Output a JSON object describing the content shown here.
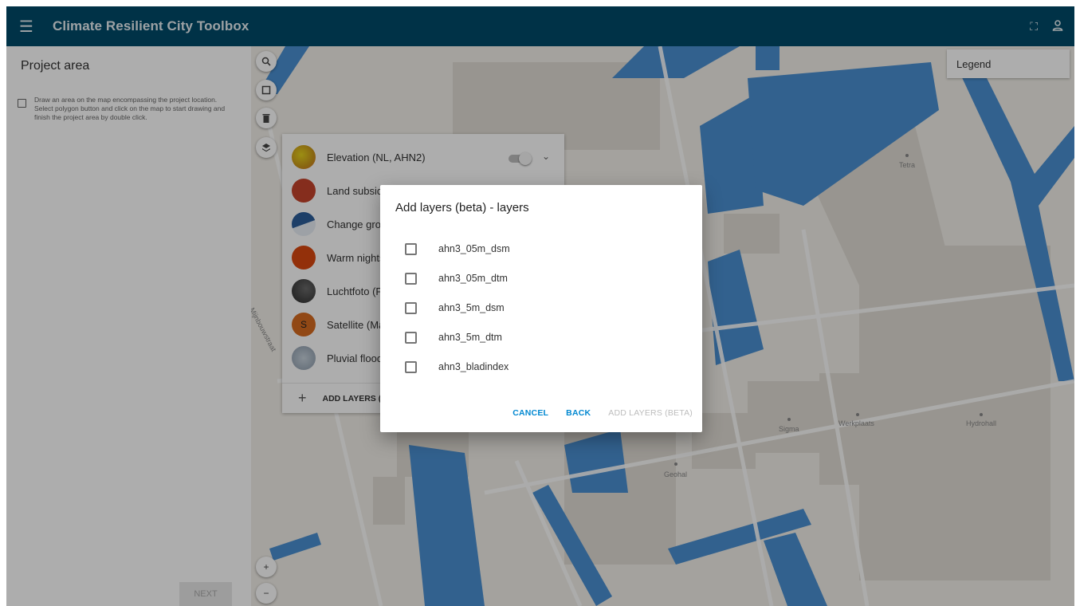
{
  "app": {
    "title": "Climate Resilient City Toolbox"
  },
  "panel": {
    "title": "Project area",
    "hint": "Draw an area on the map encompassing the project location. Select polygon button and click on the map to start drawing and finish the project area by double click.",
    "next_label": "NEXT"
  },
  "legend": {
    "label": "Legend"
  },
  "map_labels": {
    "tetra": "Tetra",
    "sigma": "Sigma",
    "werkplaats": "Werkplaats",
    "hydrohall": "Hydrohall",
    "geohal": "Geohal",
    "street": "Mijnbouwstraat"
  },
  "layers": {
    "items": [
      {
        "label": "Elevation (NL, AHN2)",
        "color": "#e8c21a"
      },
      {
        "label": "Land subsid",
        "color": "#c4432b"
      },
      {
        "label": "Change grou",
        "color": "#2c5d9a"
      },
      {
        "label": "Warm nights",
        "color": "#d9480f"
      },
      {
        "label": "Luchtfoto (P",
        "color": "#3a3a3a"
      },
      {
        "label": "Satellite (Ma",
        "color": "#d66b1f",
        "badge": "S"
      },
      {
        "label": "Pluvial flood",
        "color": "#9aa9b8"
      }
    ],
    "add_label": "ADD LAYERS ("
  },
  "dialog": {
    "title": "Add layers (beta) - layers",
    "options": [
      "ahn3_05m_dsm",
      "ahn3_05m_dtm",
      "ahn3_5m_dsm",
      "ahn3_5m_dtm",
      "ahn3_bladindex"
    ],
    "cancel_label": "CANCEL",
    "back_label": "BACK",
    "add_label": "ADD LAYERS (BETA)"
  },
  "colors": {
    "appbar": "#004b69",
    "water": "#4a8fd1",
    "land": "#f2efe9",
    "accent": "#0288d1"
  }
}
